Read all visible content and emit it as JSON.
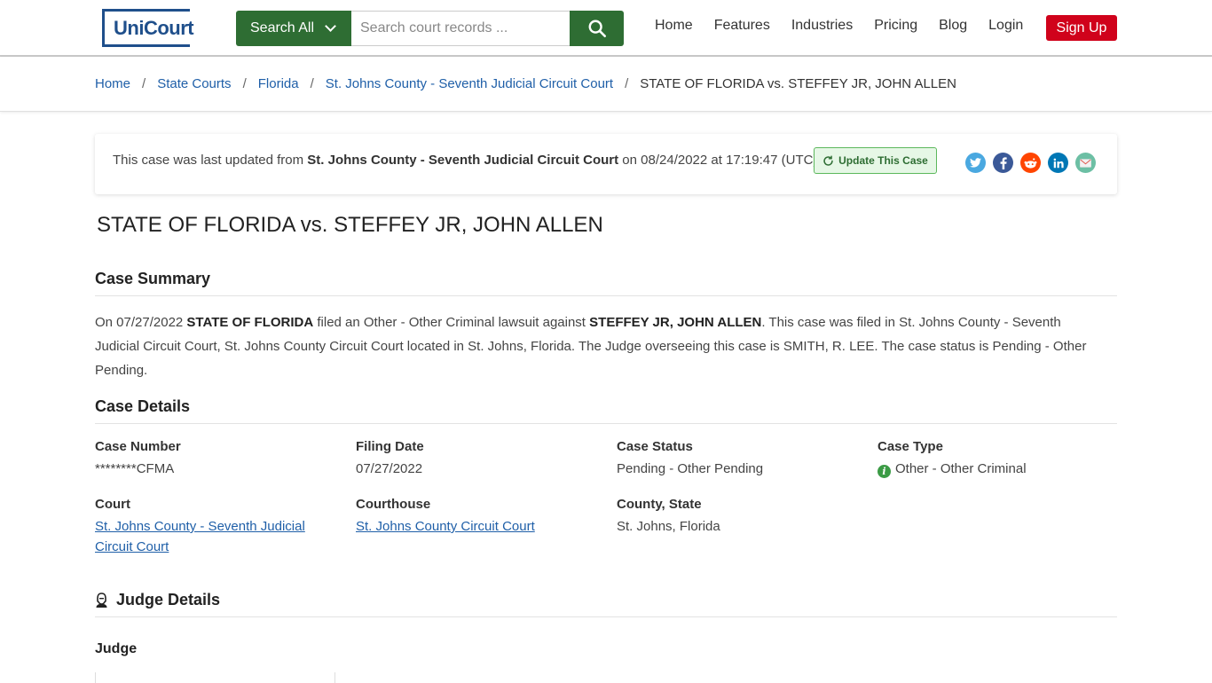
{
  "header": {
    "logo_text": "UniCourt",
    "search_scope": "Search All",
    "search_placeholder": "Search court records ...",
    "nav": [
      "Home",
      "Features",
      "Industries",
      "Pricing",
      "Blog",
      "Login"
    ],
    "signup_label": "Sign Up"
  },
  "breadcrumb": {
    "items": [
      "Home",
      "State Courts",
      "Florida",
      "St. Johns County - Seventh Judicial Circuit Court"
    ],
    "current": "STATE OF FLORIDA vs. STEFFEY JR, JOHN ALLEN",
    "separator": "/"
  },
  "update_card": {
    "prefix": "This case was last updated from ",
    "court": "St. Johns County - Seventh Judicial Circuit Court",
    "suffix": " on 08/24/2022 at 17:19:47 (UTC).",
    "button_label": "Update This Case",
    "social_icons": [
      "twitter-icon",
      "facebook-icon",
      "reddit-icon",
      "linkedin-icon",
      "email-icon"
    ]
  },
  "case_title": "STATE OF FLORIDA vs. STEFFEY JR, JOHN ALLEN",
  "summary": {
    "heading": "Case Summary",
    "t1": "On 07/27/2022 ",
    "plaintiff": "STATE OF FLORIDA",
    "t2": " filed an Other - Other Criminal lawsuit against ",
    "defendant": "STEFFEY JR, JOHN ALLEN",
    "t3": ". This case was filed in St. Johns County - Seventh Judicial Circuit Court, St. Johns County Circuit Court located in St. Johns, Florida. The Judge overseeing this case is SMITH, R. LEE. The case status is Pending - Other Pending."
  },
  "details": {
    "heading": "Case Details",
    "case_number_label": "Case Number",
    "case_number": "********CFMA",
    "filing_date_label": "Filing Date",
    "filing_date": "07/27/2022",
    "case_status_label": "Case Status",
    "case_status": "Pending - Other Pending",
    "case_type_label": "Case Type",
    "case_type": "Other - Other Criminal",
    "court_label": "Court",
    "court": "St. Johns County - Seventh Judicial Circuit Court",
    "courthouse_label": "Courthouse",
    "courthouse": "St. Johns County Circuit Court",
    "county_state_label": "County, State",
    "county_state": "St. Johns, Florida"
  },
  "judge": {
    "heading": "Judge Details",
    "label": "Judge"
  },
  "colors": {
    "brand_green": "#2e6d33",
    "link_blue": "#1f5fa8",
    "signup_red": "#d0021b",
    "logo_blue": "#1f4f8b"
  }
}
